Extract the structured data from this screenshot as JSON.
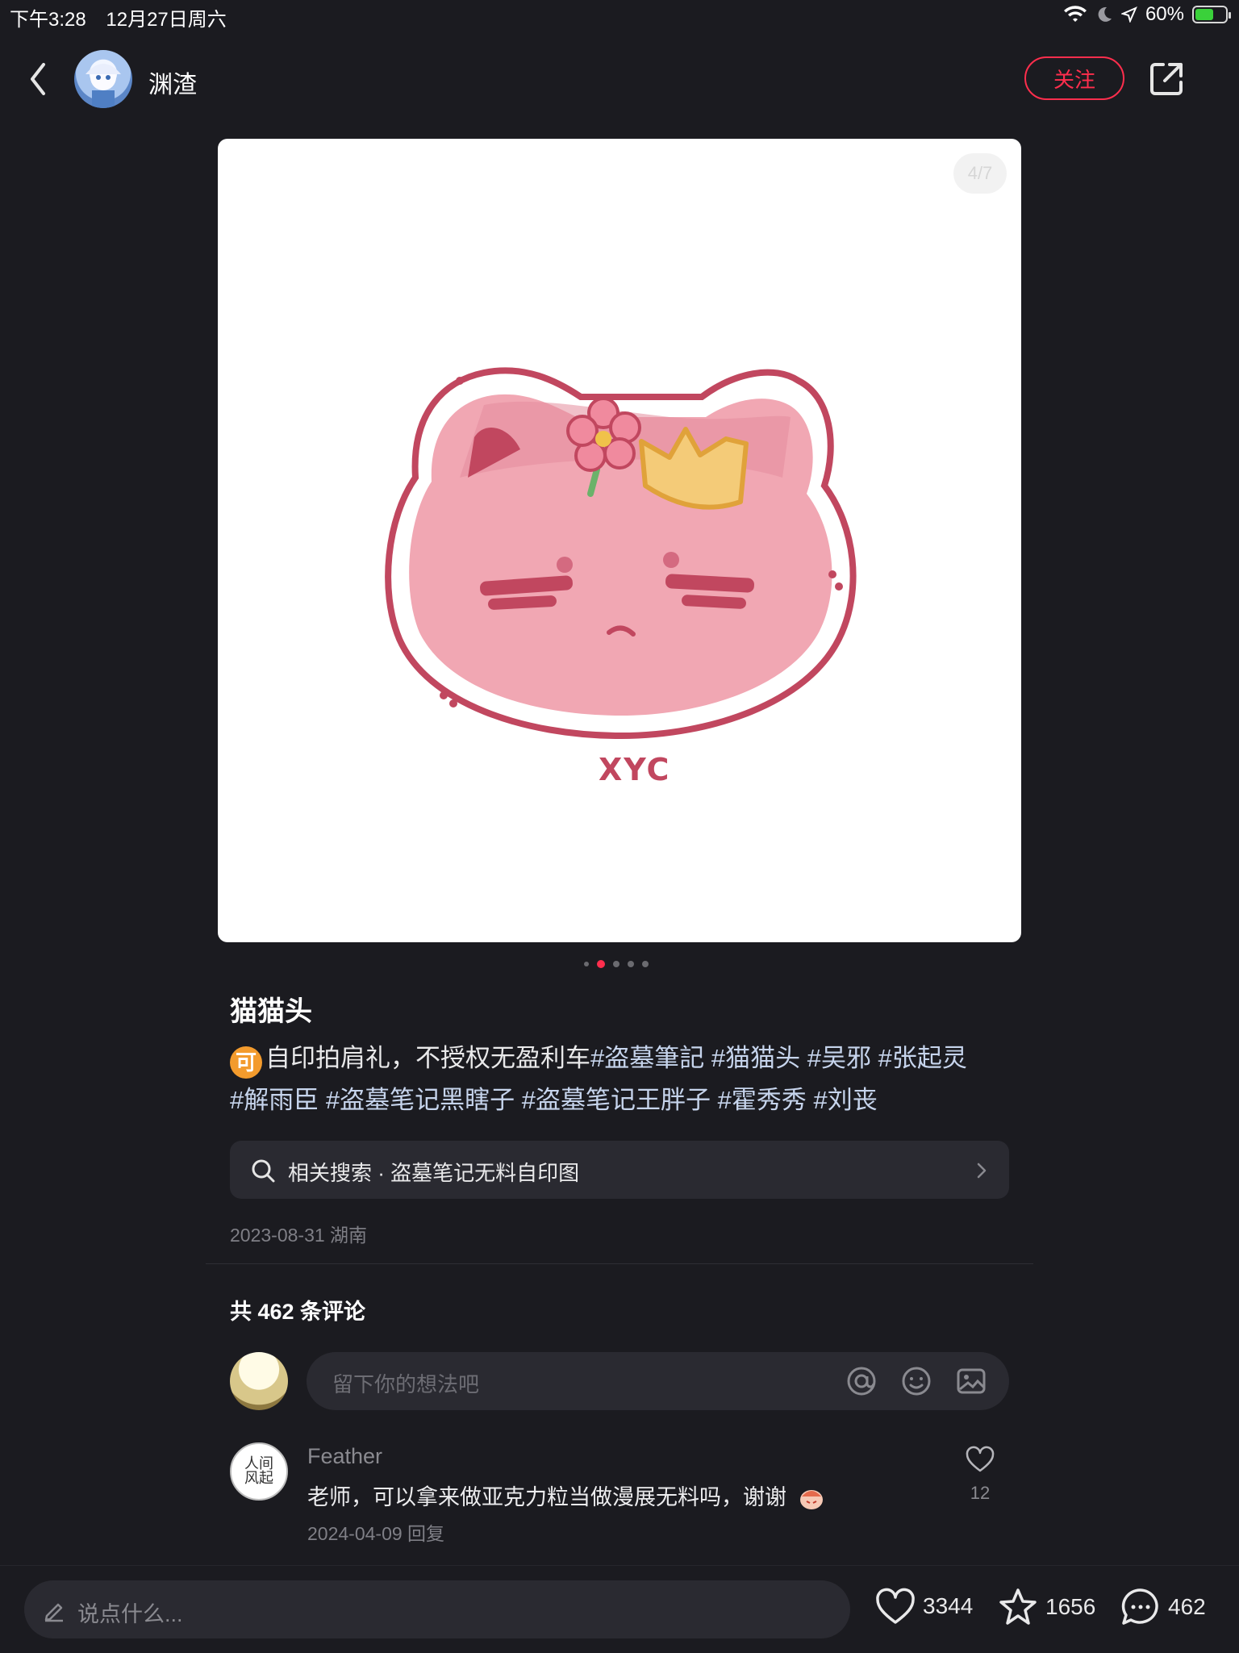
{
  "status_bar": {
    "time": "下午3:28",
    "date": "12月27日周六",
    "battery": "60%",
    "battery_level": 0.6
  },
  "header": {
    "username": "渊渣",
    "follow_label": "关注"
  },
  "image": {
    "counter": "4/7",
    "watermark": "XYC",
    "current_index": 2,
    "dot_count": 5
  },
  "post": {
    "title": "猫猫头",
    "badge": "可",
    "desc_text": "自印拍肩礼，不授权无盈利车",
    "tags_line1": [
      "#盗墓筆記",
      "#猫猫头",
      "#吴邪",
      "#张起灵"
    ],
    "tags_line2": [
      "#解雨臣",
      "#盗墓笔记黑瞎子",
      "#盗墓笔记王胖子",
      "#霍秀秀",
      "#刘丧"
    ],
    "related_search": "相关搜索 · 盗墓笔记无料自印图",
    "date_location": "2023-08-31 湖南"
  },
  "comments": {
    "count_label": "共 462 条评论",
    "input_placeholder": "留下你的想法吧",
    "items": [
      {
        "author": "Feather",
        "text": "老师，可以拿来做亚克力粒当做漫展无料吗，谢谢",
        "date": "2024-04-09",
        "reply_label": "回复",
        "likes": "12"
      }
    ]
  },
  "bottom_bar": {
    "input_placeholder": "说点什么...",
    "likes": "3344",
    "favorites": "1656",
    "comments": "462"
  },
  "colors": {
    "background": "#1b1b20",
    "accent": "#ff2e4d",
    "surface": "#2a2a31"
  }
}
